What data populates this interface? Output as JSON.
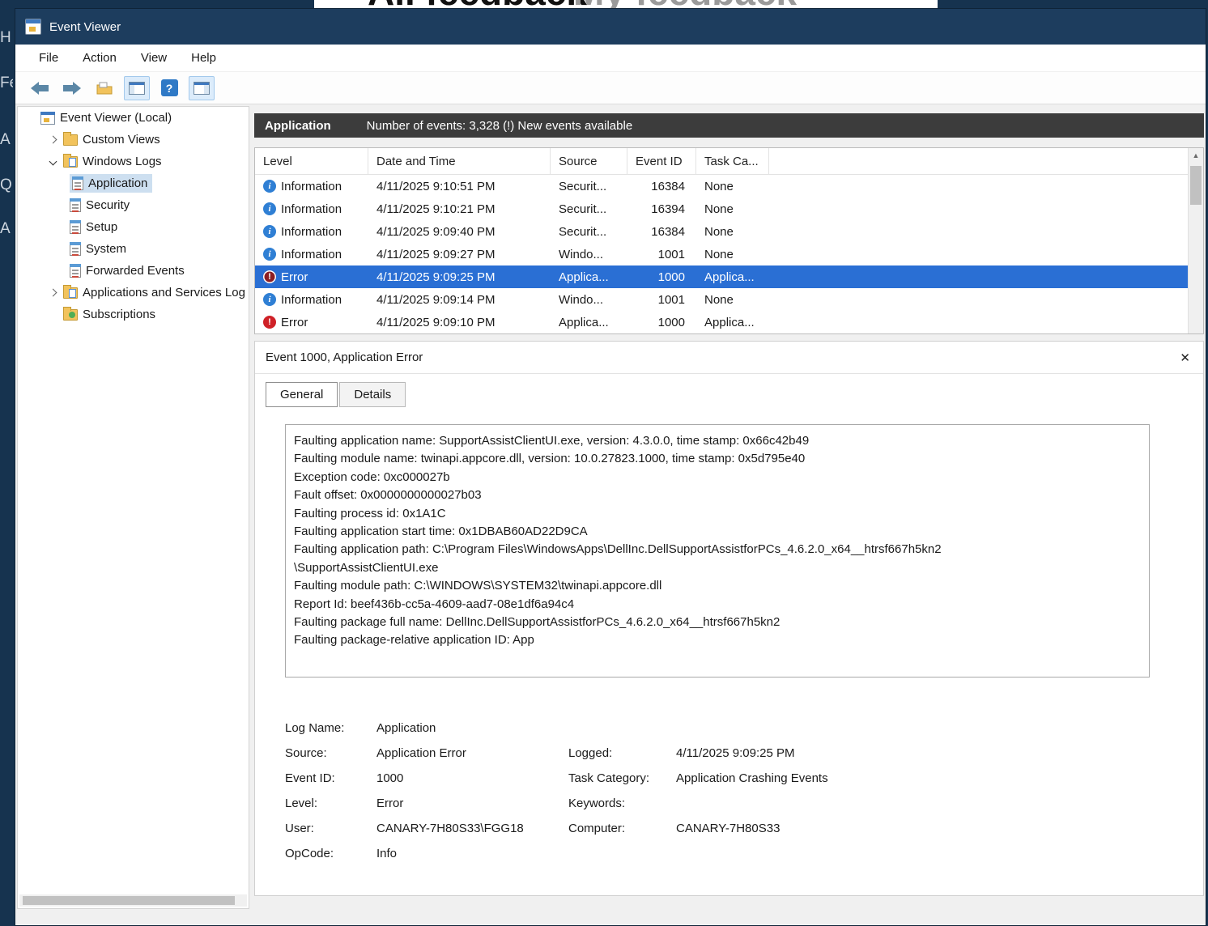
{
  "background": {
    "tabs": {
      "all": "All feedback",
      "my": "My feedback"
    },
    "left_fragments": [
      "H",
      "Fe",
      "A",
      "Q",
      "A"
    ]
  },
  "titlebar": {
    "title": "Event Viewer"
  },
  "menubar": {
    "items": [
      "File",
      "Action",
      "View",
      "Help"
    ]
  },
  "toolbar": {
    "icons": [
      "back-icon",
      "forward-icon",
      "open-saved-log-icon",
      "console-tree-icon",
      "help-icon",
      "action-pane-icon"
    ]
  },
  "tree": {
    "items": [
      {
        "label": "Event Viewer (Local)"
      },
      {
        "label": "Custom Views"
      },
      {
        "label": "Windows Logs"
      },
      {
        "label": "Application",
        "selected": true
      },
      {
        "label": "Security"
      },
      {
        "label": "Setup"
      },
      {
        "label": "System"
      },
      {
        "label": "Forwarded Events"
      },
      {
        "label": "Applications and Services Log"
      },
      {
        "label": "Subscriptions"
      }
    ]
  },
  "list": {
    "log_name": "Application",
    "summary": "Number of events: 3,328 (!) New events available",
    "columns": [
      "Level",
      "Date and Time",
      "Source",
      "Event ID",
      "Task Ca..."
    ],
    "rows": [
      {
        "level": "Information",
        "datetime": "4/11/2025 9:10:51 PM",
        "source": "Securit...",
        "event_id": "16384",
        "task": "None"
      },
      {
        "level": "Information",
        "datetime": "4/11/2025 9:10:21 PM",
        "source": "Securit...",
        "event_id": "16394",
        "task": "None"
      },
      {
        "level": "Information",
        "datetime": "4/11/2025 9:09:40 PM",
        "source": "Securit...",
        "event_id": "16384",
        "task": "None"
      },
      {
        "level": "Information",
        "datetime": "4/11/2025 9:09:27 PM",
        "source": "Windo...",
        "event_id": "1001",
        "task": "None"
      },
      {
        "level": "Error",
        "datetime": "4/11/2025 9:09:25 PM",
        "source": "Applica...",
        "event_id": "1000",
        "task": "Applica...",
        "selected": true
      },
      {
        "level": "Information",
        "datetime": "4/11/2025 9:09:14 PM",
        "source": "Windo...",
        "event_id": "1001",
        "task": "None"
      },
      {
        "level": "Error",
        "datetime": "4/11/2025 9:09:10 PM",
        "source": "Applica...",
        "event_id": "1000",
        "task": "Applica..."
      }
    ]
  },
  "detail": {
    "header": "Event 1000, Application Error",
    "tabs": [
      "General",
      "Details"
    ],
    "message": "Faulting application name: SupportAssistClientUI.exe, version: 4.3.0.0, time stamp: 0x66c42b49\nFaulting module name: twinapi.appcore.dll, version: 10.0.27823.1000, time stamp: 0x5d795e40\nException code: 0xc000027b\nFault offset: 0x0000000000027b03\nFaulting process id: 0x1A1C\nFaulting application start time: 0x1DBAB60AD22D9CA\nFaulting application path: C:\\Program Files\\WindowsApps\\DellInc.DellSupportAssistforPCs_4.6.2.0_x64__htrsf667h5kn2\n\\SupportAssistClientUI.exe\nFaulting module path: C:\\WINDOWS\\SYSTEM32\\twinapi.appcore.dll\nReport Id: beef436b-cc5a-4609-aad7-08e1df6a94c4\nFaulting package full name: DellInc.DellSupportAssistforPCs_4.6.2.0_x64__htrsf667h5kn2\nFaulting package-relative application ID: App",
    "fields": {
      "log_name_label": "Log Name:",
      "log_name": "Application",
      "source_label": "Source:",
      "source": "Application Error",
      "logged_label": "Logged:",
      "logged": "4/11/2025 9:09:25 PM",
      "event_id_label": "Event ID:",
      "event_id": "1000",
      "task_category_label": "Task Category:",
      "task_category": "Application Crashing Events",
      "level_label": "Level:",
      "level": "Error",
      "keywords_label": "Keywords:",
      "keywords": "",
      "user_label": "User:",
      "user": "CANARY-7H80S33\\FGG18",
      "computer_label": "Computer:",
      "computer": "CANARY-7H80S33",
      "opcode_label": "OpCode:",
      "opcode": "Info"
    },
    "accent_selected_row": "#2a6fd4",
    "error_color": "#cf2127",
    "info_color": "#2f7fd4"
  }
}
